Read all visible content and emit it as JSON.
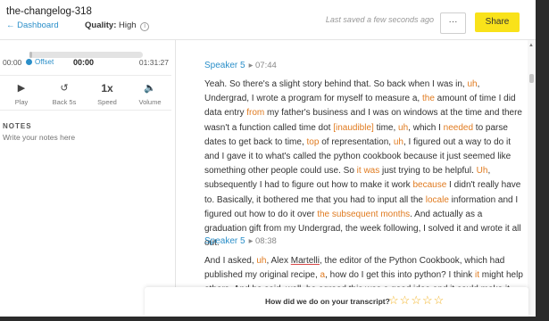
{
  "header": {
    "title": "the-changelog-318",
    "back_label": "← Dashboard",
    "quality_label": "Quality:",
    "quality_value": "High",
    "info_glyph": "i",
    "saved_text": "Last saved a few seconds ago",
    "more_label": "···",
    "share_label": "Share"
  },
  "player": {
    "progress_fraction": 0.0,
    "time_start": "00:00",
    "offset_label": "Offset",
    "offset_time": "00:00",
    "time_end": "01:31:27",
    "controls": [
      {
        "label": "Play",
        "icon": "play-icon",
        "glyph": "▶"
      },
      {
        "label": "Back 5s",
        "icon": "rewind-icon",
        "glyph": "↺"
      },
      {
        "label": "Speed",
        "icon": "speed-icon",
        "glyph": "1x"
      },
      {
        "label": "Volume",
        "icon": "volume-icon",
        "glyph": "🔈"
      }
    ]
  },
  "notes": {
    "heading": "NOTES",
    "placeholder": "Write your notes here"
  },
  "transcript": {
    "blocks": [
      {
        "speaker": "Speaker 5",
        "time": "▸ 07:44"
      },
      {
        "speaker": "Speaker 5",
        "time": "▸ 08:38"
      }
    ]
  },
  "feedback": {
    "question": "How did we do on your transcript?",
    "stars": [
      "☆",
      "☆",
      "☆",
      "☆",
      "☆"
    ]
  },
  "colors": {
    "accent": "#2b8fc9",
    "share": "#f9e21a",
    "highlight": "#e07b20",
    "star": "#f2b01e"
  }
}
